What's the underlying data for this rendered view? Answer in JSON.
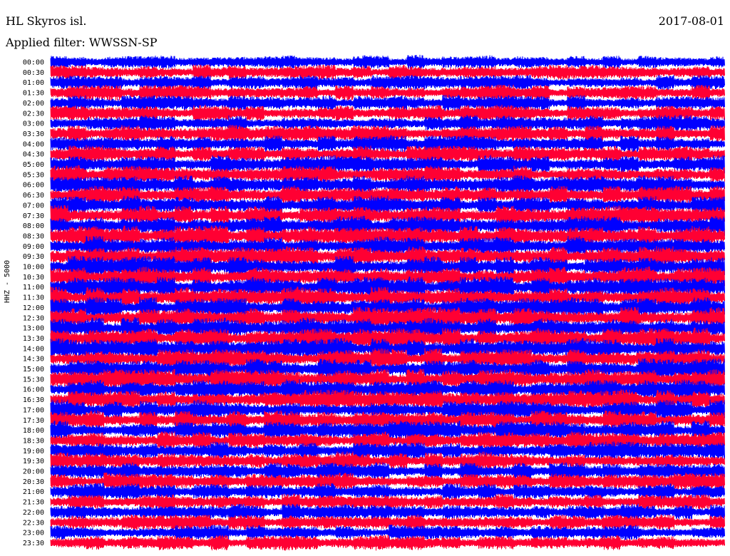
{
  "header": {
    "station": "HL Skyros isl.",
    "date": "2017-08-01",
    "filter": "Applied filter: WWSSN-SP"
  },
  "chart_data": {
    "type": "line",
    "title": "HL Skyros isl.",
    "subtitle": "Applied filter: WWSSN-SP",
    "date": "2017-08-01",
    "ylabel": "HHZ - 5000",
    "tick_labels": [
      "00:00",
      "00:30",
      "01:00",
      "01:30",
      "02:00",
      "02:30",
      "03:00",
      "03:30",
      "04:00",
      "04:30",
      "05:00",
      "05:30",
      "06:00",
      "06:30",
      "07:00",
      "07:30",
      "08:00",
      "08:30",
      "09:00",
      "09:30",
      "10:00",
      "10:30",
      "11:00",
      "11:30",
      "12:00",
      "12:30",
      "13:00",
      "13:30",
      "14:00",
      "14:30",
      "15:00",
      "15:30",
      "16:00",
      "16:30",
      "17:00",
      "17:30",
      "18:00",
      "18:30",
      "19:00",
      "19:30",
      "20:00",
      "20:30",
      "21:00",
      "21:30",
      "22:00",
      "22:30",
      "23:00",
      "23:30"
    ],
    "colors": [
      "#0000ff",
      "#ff0033"
    ],
    "grid": false
  }
}
